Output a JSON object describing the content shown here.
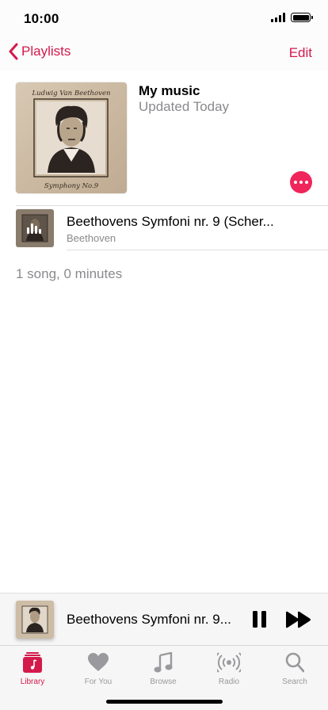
{
  "status_bar": {
    "time": "10:00"
  },
  "nav": {
    "back_label": "Playlists",
    "edit_label": "Edit"
  },
  "playlist": {
    "title": "My music",
    "subtitle": "Updated Today",
    "cover_top_text": "Ludwig Van Beethoven",
    "cover_bottom_text": "Symphony No.9"
  },
  "songs": [
    {
      "title": "Beethovens Symfoni nr. 9 (Scher...",
      "artist": "Beethoven",
      "playing": true
    }
  ],
  "summary": "1 song, 0 minutes",
  "now_playing": {
    "title": "Beethovens Symfoni nr. 9..."
  },
  "tabs": [
    {
      "label": "Library",
      "icon": "library-icon",
      "active": true
    },
    {
      "label": "For You",
      "icon": "heart-icon",
      "active": false
    },
    {
      "label": "Browse",
      "icon": "music-note-icon",
      "active": false
    },
    {
      "label": "Radio",
      "icon": "radio-icon",
      "active": false
    },
    {
      "label": "Search",
      "icon": "search-icon",
      "active": false
    }
  ],
  "colors": {
    "accent": "#d31a4b",
    "more_button": "#f0255b",
    "secondary_text": "#8a8a8e"
  }
}
